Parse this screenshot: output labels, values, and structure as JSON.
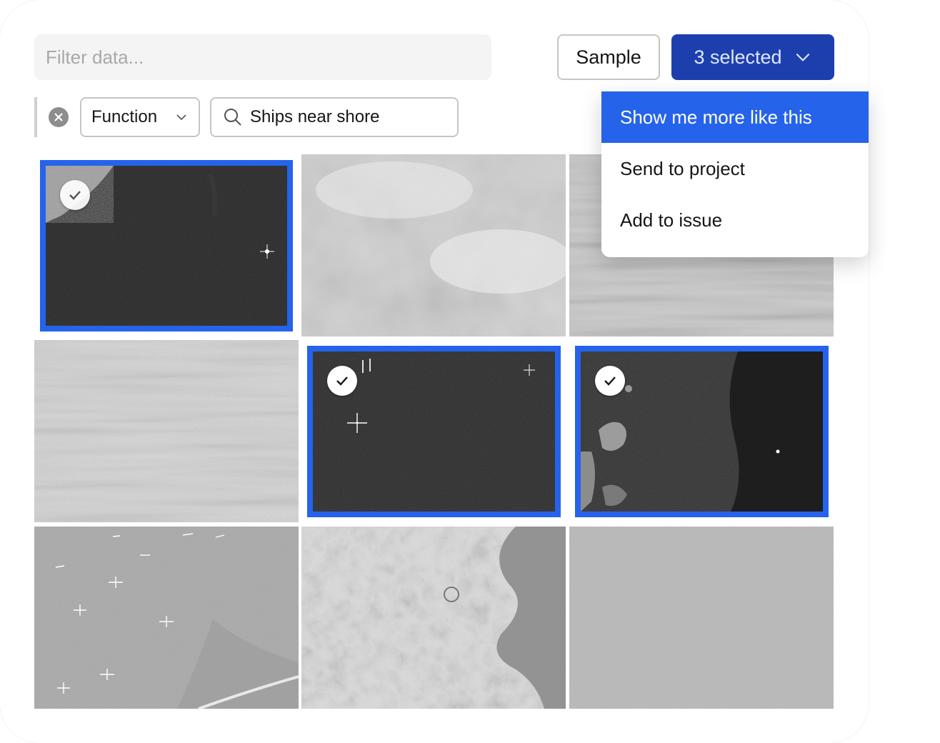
{
  "filter": {
    "placeholder": "Filter data..."
  },
  "toolbar": {
    "sample_label": "Sample",
    "selection_label": "3 selected"
  },
  "filters": {
    "function_label": "Function",
    "search_value": "Ships near shore"
  },
  "dropdown": {
    "items": [
      {
        "label": "Show me more like this",
        "active": true
      },
      {
        "label": "Send to project",
        "active": false
      },
      {
        "label": "Add to issue",
        "active": false
      }
    ]
  },
  "grid": {
    "tiles": [
      {
        "row": 1,
        "col": 1,
        "kind": "dark-coast",
        "selected": true
      },
      {
        "row": 1,
        "col": 2,
        "kind": "light-clouds",
        "selected": false
      },
      {
        "row": 1,
        "col": 3,
        "kind": "light-streaks",
        "selected": false
      },
      {
        "row": 2,
        "col": 1,
        "kind": "light-texture",
        "selected": false
      },
      {
        "row": 2,
        "col": 2,
        "kind": "dark-ships",
        "selected": true
      },
      {
        "row": 2,
        "col": 3,
        "kind": "dark-islands",
        "selected": true
      },
      {
        "row": 3,
        "col": 1,
        "kind": "gray-ships",
        "selected": false
      },
      {
        "row": 3,
        "col": 2,
        "kind": "light-terrain",
        "selected": false
      },
      {
        "row": 3,
        "col": 3,
        "kind": "gray-plain",
        "selected": false
      }
    ]
  },
  "colors": {
    "accent": "#2563eb",
    "primary_button": "#1d3fae",
    "border": "#c6c6c6"
  },
  "icons": [
    "close-icon",
    "chevron-down-icon",
    "search-icon",
    "checkmark-icon"
  ]
}
